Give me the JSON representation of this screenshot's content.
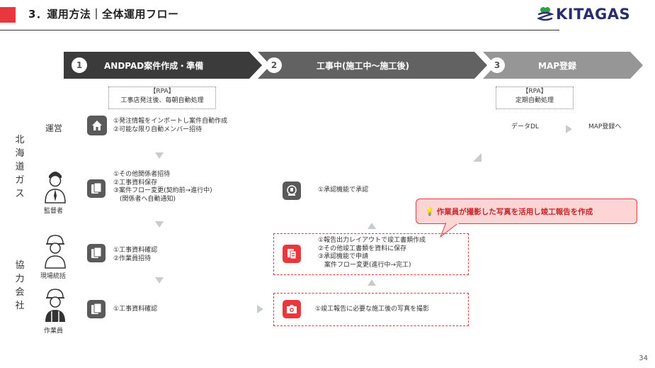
{
  "header": {
    "title": "3．運用方法｜全体運用フロー",
    "logo_text": "KITAGAS",
    "accent_color": "#e8383d"
  },
  "phases": [
    {
      "number": "1",
      "label": "ANDPAD案件作成・準備",
      "color": "#3b3b3b"
    },
    {
      "number": "2",
      "label": "工事中(施工中〜施工後)",
      "color": "#626262"
    },
    {
      "number": "3",
      "label": "MAP登録",
      "color": "#969696"
    }
  ],
  "rpa_boxes": [
    {
      "line1": "【RPA】",
      "line2": "工事店発注後、毎朝自動処理"
    },
    {
      "line1": "【RPA】",
      "line2": "定期自動処理"
    }
  ],
  "groups": {
    "hokkaido_gas": "北海道ガス",
    "kyoryoku": "協力会社"
  },
  "roles": {
    "unei": "運営",
    "kantokusha": "監督者",
    "genba": "現場統括",
    "sagyoin": "作業員"
  },
  "steps": {
    "unei_p1": [
      "①発注情報をインポートし案件自動作成",
      "②可能な限り自動メンバー招待"
    ],
    "unei_p3_a": "データDL",
    "unei_p3_b": "MAP登録へ",
    "kantoku_p1": [
      "①その他関係者招待",
      "②工事資料保存",
      "③案件フロー変更(契約前→進行中)",
      "　(関係者へ自動通知)"
    ],
    "kantoku_p2": "①承認機能で承認",
    "genba_p1": [
      "①工事資料確認",
      "②作業員招待"
    ],
    "genba_p2": [
      "①報告出力レイアウトで竣工書類作成",
      "②その他竣工書類を資料に保存",
      "③承認機能で申請",
      "　案件フロー変更(進行中→完工)"
    ],
    "sagyo_p1": "①工事資料確認",
    "sagyo_p2": "①竣工報告に必要な施工後の写真を撮影"
  },
  "callout": {
    "icon": "lightbulb-icon",
    "text": "作業員が撮影した写真を活用し竣工報告を作成"
  },
  "page_number": "34"
}
